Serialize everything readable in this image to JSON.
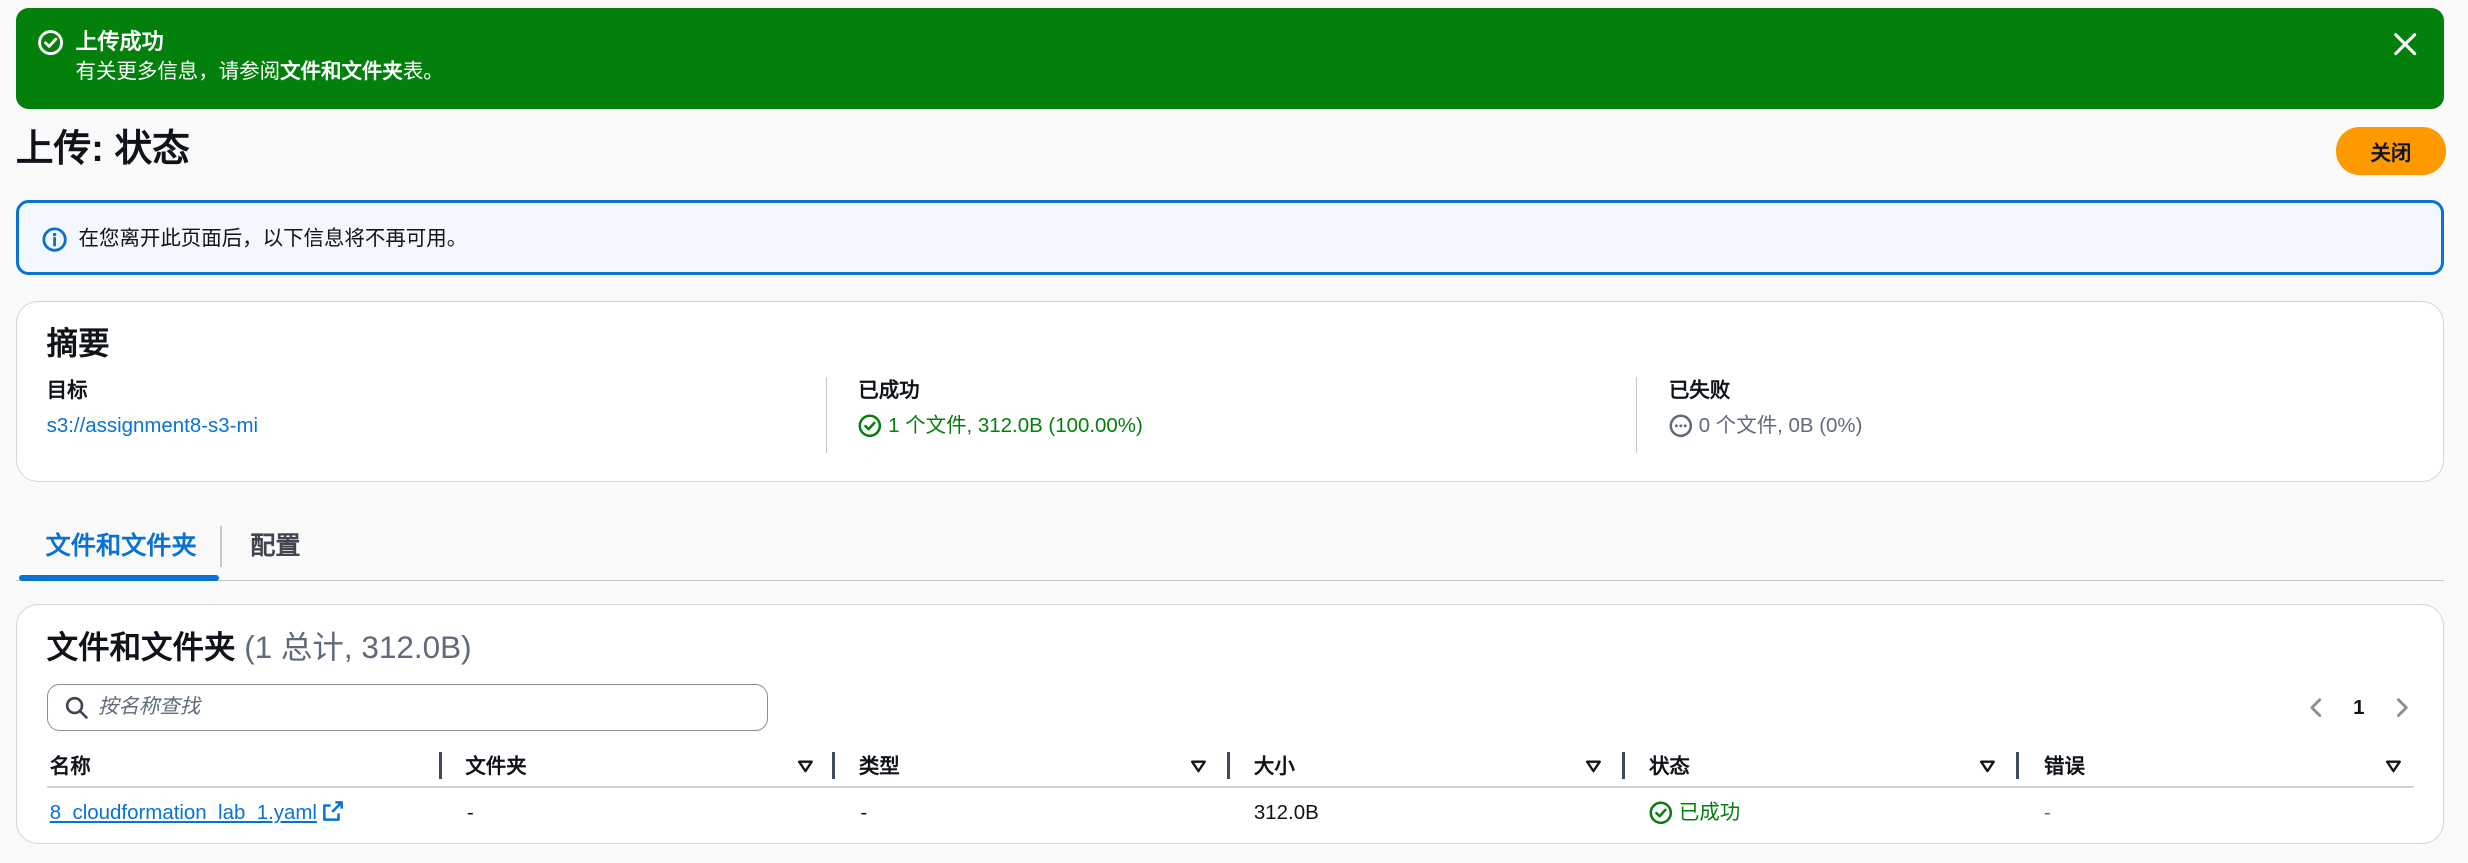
{
  "flash": {
    "title": "上传成功",
    "desc_prefix": "有关更多信息，请参阅",
    "desc_link": "文件和文件夹",
    "desc_suffix": "表。"
  },
  "header": {
    "title": "上传: 状态",
    "close_button": "关闭"
  },
  "info_alert": {
    "text": "在您离开此页面后，以下信息将不再可用。"
  },
  "summary": {
    "title": "摘要",
    "destination_label": "目标",
    "destination_value": "s3://assignment8-s3-mi",
    "succeeded_label": "已成功",
    "succeeded_value": "1 个文件, 312.0B (100.00%)",
    "failed_label": "已失败",
    "failed_value": "0 个文件, 0B (0%)"
  },
  "tabs": [
    {
      "label": "文件和文件夹",
      "active": true
    },
    {
      "label": "配置",
      "active": false
    }
  ],
  "files_table": {
    "title": "文件和文件夹",
    "count": "(1 总计, 312.0B)",
    "search_placeholder": "按名称查找",
    "page": "1",
    "columns": [
      "名称",
      "文件夹",
      "类型",
      "大小",
      "状态",
      "错误"
    ],
    "rows": [
      {
        "name": "8_cloudformation_lab_1.yaml",
        "folder": "-",
        "type": "-",
        "size": "312.0B",
        "status": "已成功",
        "error": "-"
      }
    ]
  },
  "colors": {
    "success": "#037f0c",
    "link": "#0972d3",
    "primary_button": "#ff9900",
    "info_border": "#0972d3"
  },
  "icons": {
    "flash": "check-circle-icon",
    "close": "close-icon",
    "info": "info-icon",
    "success": "check-circle-icon",
    "failed": "ellipsis-circle-icon",
    "search": "search-icon",
    "external": "external-link-icon",
    "sort": "sort-caret-down-icon"
  }
}
